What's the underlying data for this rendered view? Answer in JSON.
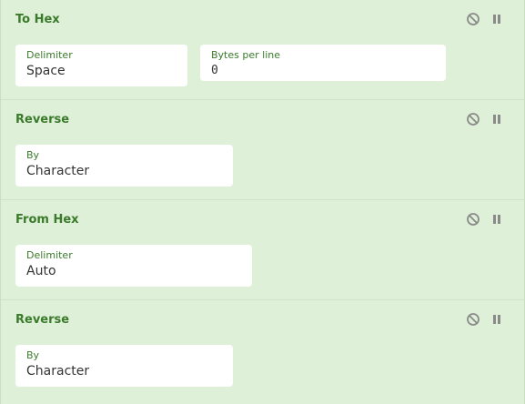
{
  "operations": [
    {
      "title": "To Hex",
      "fields": [
        {
          "label": "Delimiter",
          "value": "Space"
        },
        {
          "label": "Bytes per line",
          "value": "0"
        }
      ]
    },
    {
      "title": "Reverse",
      "fields": [
        {
          "label": "By",
          "value": "Character"
        }
      ]
    },
    {
      "title": "From Hex",
      "fields": [
        {
          "label": "Delimiter",
          "value": "Auto"
        }
      ]
    },
    {
      "title": "Reverse",
      "fields": [
        {
          "label": "By",
          "value": "Character"
        }
      ]
    }
  ],
  "icons": {
    "disable": "disable-icon",
    "pause": "pause-icon"
  },
  "colors": {
    "background": "#dff0d8",
    "title": "#3a7a2a",
    "icon": "#8a8a8a"
  }
}
